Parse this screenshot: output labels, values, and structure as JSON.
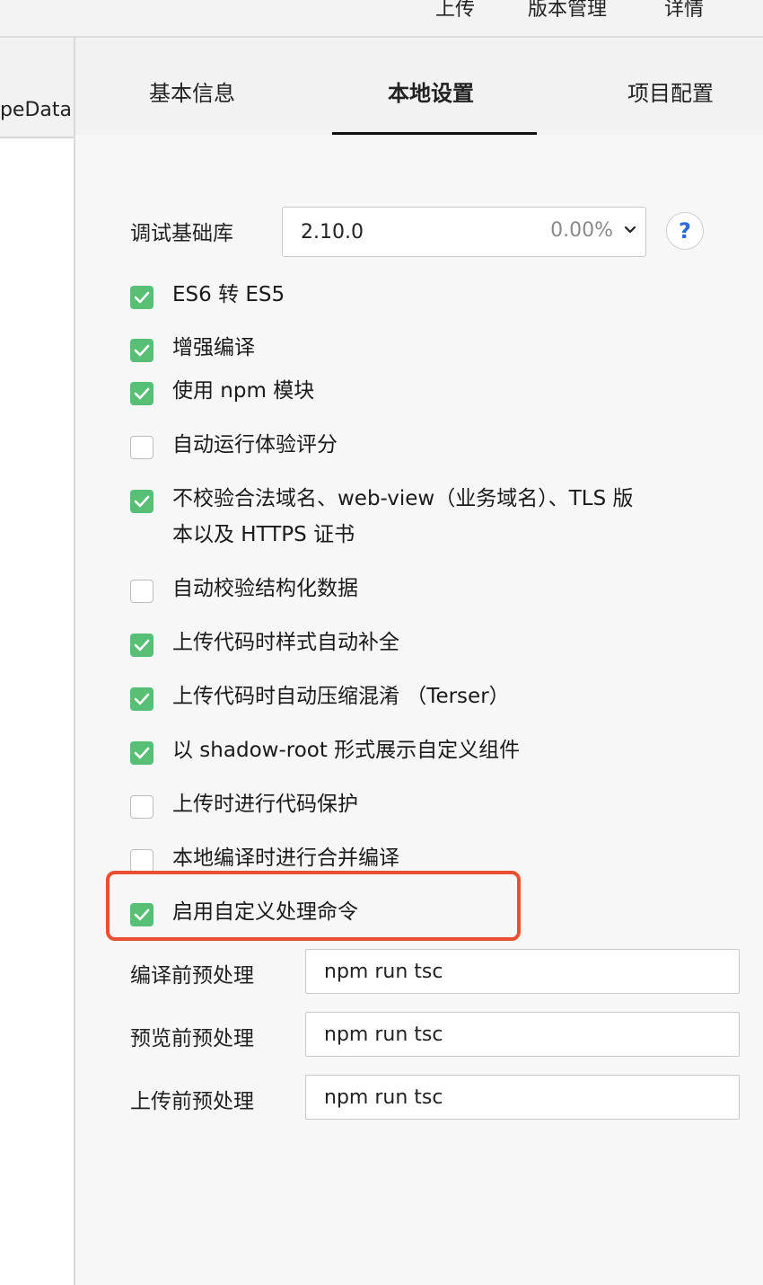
{
  "toolbar": {
    "upload": "上传",
    "version": "版本管理",
    "details": "详情"
  },
  "left_panel": {
    "label": "ppeData"
  },
  "tabs": {
    "basic": "基本信息",
    "local": "本地设置",
    "project": "项目配置"
  },
  "debug_lib": {
    "label": "调试基础库",
    "value": "2.10.0",
    "percent": "0.00%",
    "help": "?"
  },
  "options": [
    {
      "label": "ES6 转 ES5",
      "checked": true
    },
    {
      "label": "增强编译",
      "checked": true
    },
    {
      "label": "使用 npm 模块",
      "checked": true
    },
    {
      "label": "自动运行体验评分",
      "checked": false
    },
    {
      "label": "不校验合法域名、web-view（业务域名）、TLS 版",
      "label2": "本以及 HTTPS 证书",
      "checked": true
    },
    {
      "label": "自动校验结构化数据",
      "checked": false
    },
    {
      "label": "上传代码时样式自动补全",
      "checked": true
    },
    {
      "label": "上传代码时自动压缩混淆 （Terser）",
      "checked": true
    },
    {
      "label": "以 shadow-root 形式展示自定义组件",
      "checked": true
    },
    {
      "label": "上传时进行代码保护",
      "checked": false
    },
    {
      "label": "本地编译时进行合并编译",
      "checked": false
    },
    {
      "label": "启用自定义处理命令",
      "checked": true
    }
  ],
  "preprocess": {
    "compile": {
      "label": "编译前预处理",
      "value": "npm run tsc"
    },
    "preview": {
      "label": "预览前预处理",
      "value": "npm run tsc"
    },
    "upload": {
      "label": "上传前预处理",
      "value": "npm run tsc"
    }
  },
  "colors": {
    "check_on": "#57c074",
    "highlight": "#e8502f",
    "help": "#2f6bd8"
  }
}
